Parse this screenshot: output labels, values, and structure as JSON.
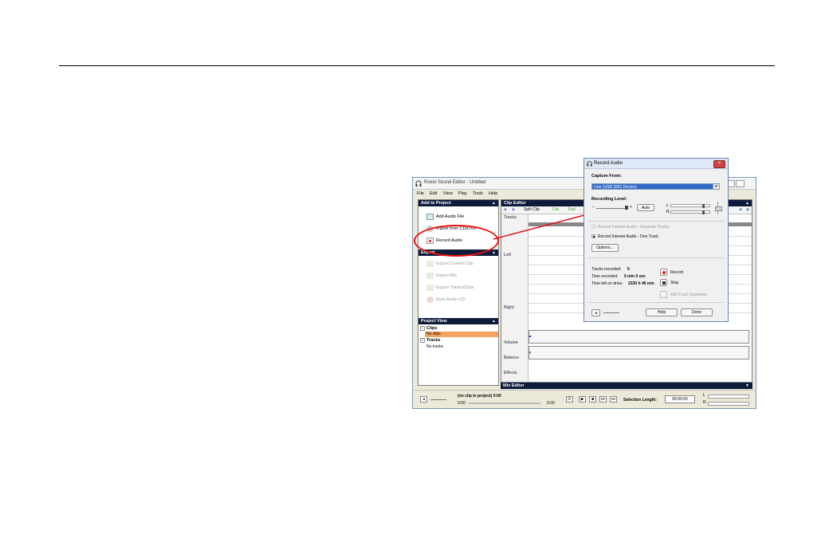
{
  "app": {
    "title": "Roxio Sound Editor - Untitled",
    "menu": [
      "File",
      "Edit",
      "View",
      "Play",
      "Tools",
      "Help"
    ]
  },
  "add_to_project": {
    "header": "Add to Project",
    "items": [
      "Add Audio File",
      "Import from CD/DVD",
      "Record Audio"
    ]
  },
  "export": {
    "header": "Export",
    "items": [
      "Export Current Clip",
      "Export Mix",
      "Export Tracks/Clips",
      "Burn Audio CD"
    ]
  },
  "project_view": {
    "header": "Project View",
    "clips_label": "Clips",
    "clips_value": "No clips",
    "tracks_label": "Tracks",
    "tracks_value": "No tracks"
  },
  "clip_editor": {
    "header": "Clip Editor",
    "toolbar": {
      "split": "Split Clip",
      "cut": "Cut",
      "fade": "Fad"
    },
    "labels": {
      "tracks": "Tracks",
      "left": "Left",
      "right": "Right",
      "volume": "Volume",
      "balance": "Balance",
      "effects": "Effects"
    }
  },
  "mix_editor": {
    "header": "Mix Editor"
  },
  "status": {
    "clip_info": "(no clip in project)  0:00",
    "time_start": "0:00",
    "time_end": "0:00",
    "selection_label": "Selection Length:",
    "selection_value": "00:00:00",
    "l": "L",
    "r": "R"
  },
  "dialog": {
    "title": "Record Audio",
    "capture_from_label": "Capture From:",
    "capture_from_value": "Line (USB 2861 Device)",
    "recording_level_label": "Recording Level:",
    "auto_button": "Auto",
    "meter_l": "L",
    "meter_r": "R",
    "minus": "–",
    "plus": "+",
    "radio_separate": "Record Internet Audio - Separate Tracks",
    "radio_one": "Record Internet Audio - One Track",
    "options_button": "Options...",
    "tracks_recorded_label": "Tracks recorded:",
    "tracks_recorded_value": "0",
    "time_recorded_label": "Time recorded:",
    "time_recorded_value": "0 min 0 sec",
    "time_left_label": "Time left on drive:",
    "time_left_value": "2330 h 46 min",
    "record_button": "Record",
    "stop_button": "Stop",
    "add_track_button": "Add Track Separator",
    "help_button": "Help",
    "done_button": "Done"
  },
  "colors": {
    "panel_header": "#0d1b3a",
    "highlight": "#f4a460",
    "annotation": "#e11111",
    "selection": "#3169c6"
  }
}
